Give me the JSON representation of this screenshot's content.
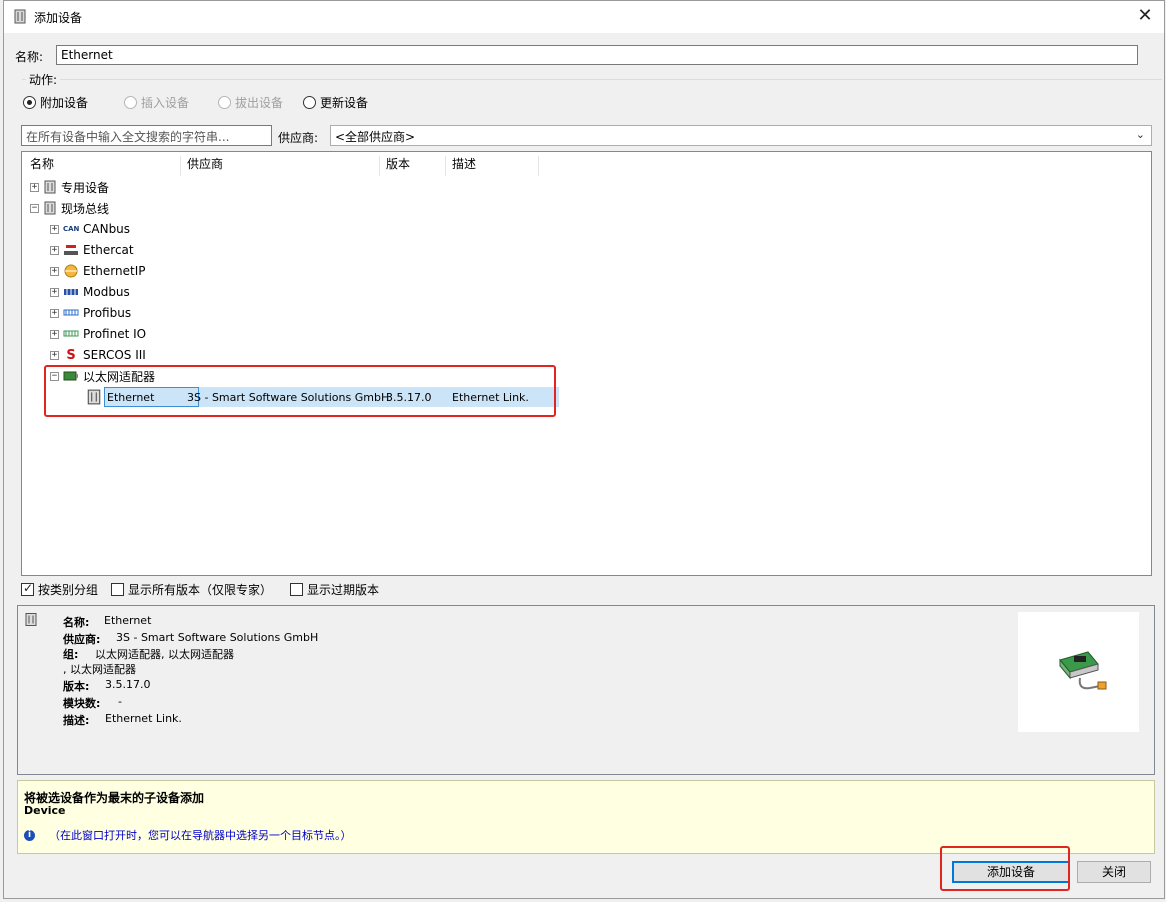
{
  "window": {
    "title": "添加设备",
    "close_glyph": "✕"
  },
  "name": {
    "label": "名称:",
    "value": "Ethernet"
  },
  "action": {
    "title": "动作:",
    "options": [
      {
        "label": "附加设备",
        "state": "selected"
      },
      {
        "label": "插入设备",
        "state": "disabled"
      },
      {
        "label": "拔出设备",
        "state": "disabled"
      },
      {
        "label": "更新设备",
        "state": "unselected"
      }
    ]
  },
  "search": {
    "placeholder": "在所有设备中输入全文搜索的字符串..."
  },
  "vendor": {
    "label": "供应商:",
    "value": "<全部供应商>"
  },
  "tree": {
    "columns": [
      "名称",
      "供应商",
      "版本",
      "描述"
    ],
    "nodes": [
      {
        "label": "专用设备",
        "expander": "+"
      },
      {
        "label": "现场总线",
        "expander": "−"
      },
      {
        "label": "CANbus",
        "expander": "+",
        "icon_text": "CAN"
      },
      {
        "label": "Ethercat",
        "expander": "+"
      },
      {
        "label": "EthernetIP",
        "expander": "+"
      },
      {
        "label": "Modbus",
        "expander": "+"
      },
      {
        "label": "Profibus",
        "expander": "+"
      },
      {
        "label": "Profinet IO",
        "expander": "+"
      },
      {
        "label": "SERCOS III",
        "expander": "+",
        "icon_text": "S"
      },
      {
        "label": "以太网适配器",
        "expander": "−"
      }
    ],
    "selected_row": {
      "name": "Ethernet",
      "vendor": "3S - Smart Software Solutions GmbH",
      "version": "3.5.17.0",
      "description": "Ethernet Link."
    }
  },
  "options": [
    {
      "label": "按类别分组",
      "checked": true
    },
    {
      "label": "显示所有版本（仅限专家）",
      "checked": false
    },
    {
      "label": "显示过期版本",
      "checked": false
    }
  ],
  "info": {
    "name_label": "名称:",
    "name_value": "Ethernet",
    "vendor_label": "供应商:",
    "vendor_value": "3S - Smart Software Solutions GmbH",
    "group_label": "组:",
    "group_value": "以太网适配器,  以太网适配器",
    "group_value2": ",  以太网适配器",
    "version_label": "版本:",
    "version_value": "3.5.17.0",
    "modules_label": "模块数:",
    "modules_value": "-",
    "desc_label": "描述:",
    "desc_value": "Ethernet Link."
  },
  "message": {
    "title": "将被选设备作为最末的子设备添加",
    "subtitle": "Device",
    "hint_icon": "i",
    "hint": "（在此窗口打开时，您可以在导航器中选择另一个目标节点。）"
  },
  "buttons": {
    "add": "添加设备",
    "close": "关闭"
  },
  "colors": {
    "highlight": "#e0261e",
    "selection": "#cce4f7",
    "hint_text": "#0000cc"
  }
}
